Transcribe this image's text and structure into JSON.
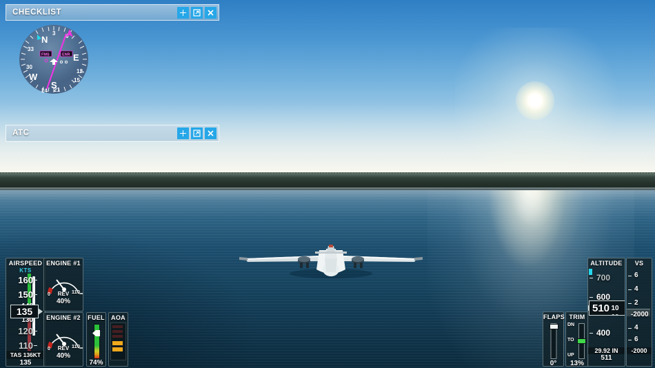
{
  "scene": {
    "description": "Flight simulator external view of twin-engine aircraft over water",
    "sky_color": "#4a96d2",
    "water_color": "#174561",
    "treeline_color": "#26332c",
    "sun_color": "#fffdf2",
    "aircraft_color": "#e8eef0"
  },
  "windows": [
    {
      "id": "checklist",
      "title": "CHECKLIST",
      "buttons": [
        {
          "name": "add-icon",
          "glyph": "+"
        },
        {
          "name": "popout-icon",
          "glyph": "↗"
        },
        {
          "name": "close-icon",
          "glyph": "✕"
        }
      ]
    },
    {
      "id": "atc",
      "title": "ATC",
      "buttons": [
        {
          "name": "add-icon",
          "glyph": "+"
        },
        {
          "name": "popout-icon",
          "glyph": "↗"
        },
        {
          "name": "close-icon",
          "glyph": "✕"
        }
      ]
    }
  ],
  "hsi": {
    "cardinals": [
      "N",
      "E",
      "S",
      "W"
    ],
    "numbers": [
      "3",
      "6",
      "12",
      "15",
      "21",
      "24",
      "30",
      "33"
    ],
    "badges": [
      {
        "label": "FMS",
        "color": "#ff3cf0"
      },
      {
        "label": "ENR",
        "color": "#ff3cf0"
      }
    ],
    "course_needle_color": "#e838e0",
    "heading_bug_color": "#27d7ec",
    "heading_arrow_color": "#e838e0"
  },
  "airspeed": {
    "title": "AIRSPEED",
    "units": "KTS",
    "value": "135",
    "ticks": [
      "160",
      "150",
      "146",
      "130",
      "120",
      "110"
    ],
    "tas_label": "TAS 136KT",
    "bottom_value": "135",
    "band_green": "#2bbf3a",
    "band_red": "#c8404a",
    "band_white": "#f2f7f7"
  },
  "engine1": {
    "title": "ENGINE #1",
    "scale_min": "0",
    "scale_max": "110",
    "mode": "REV",
    "value": "40%",
    "needle_color": "#ffffff",
    "redzone_color": "#c4261d"
  },
  "engine2": {
    "title": "ENGINE #2",
    "scale_min": "0",
    "scale_max": "110",
    "mode": "REV",
    "value": "40%",
    "needle_color": "#ffffff",
    "redzone_color": "#c4261d"
  },
  "fuel": {
    "title": "FUEL",
    "value": "74%",
    "bar_color": "#2bbf3a",
    "pointer_color": "#ffffff"
  },
  "aoa": {
    "title": "AOA",
    "segments": [
      {
        "color": "#7a2222",
        "bright": false
      },
      {
        "color": "#7a2222",
        "bright": false
      },
      {
        "color": "#7a2222",
        "bright": false
      },
      {
        "color": "#f0a81c",
        "bright": true
      },
      {
        "color": "#f0a81c",
        "bright": true
      }
    ]
  },
  "flaps": {
    "title": "FLAPS",
    "value": "0°",
    "knob_color": "#eef3f3"
  },
  "trim": {
    "title": "TRIM",
    "value": "13%",
    "label_top": "DN",
    "label_mid": "TO",
    "label_bottom": "UP",
    "knob_color": "#3fd94a"
  },
  "altitude": {
    "title": "ALTITUDE",
    "value": "510",
    "drum_above": "20",
    "drum_center": "10",
    "drum_below": "00",
    "ticks": [
      "700",
      "600",
      "400"
    ],
    "baro": "29.92 IN",
    "bottom_value": "511",
    "bug_color": "#27d7ec"
  },
  "vs": {
    "title": "VS",
    "ticks_up": [
      "6",
      "4",
      "2"
    ],
    "ticks_down": [
      "4",
      "6"
    ],
    "marker": "-2000",
    "bottom_value": "-2000"
  }
}
